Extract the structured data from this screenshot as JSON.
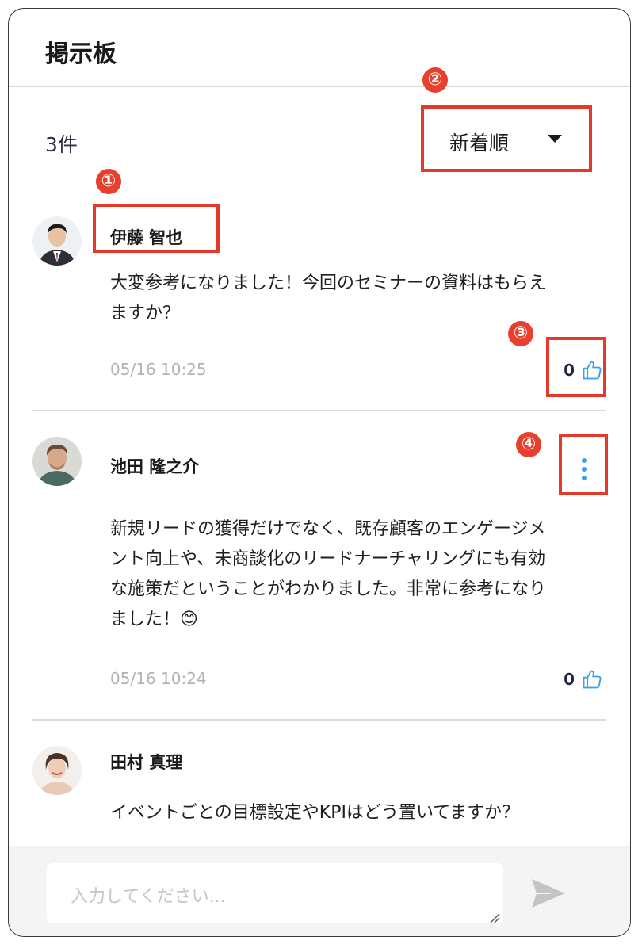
{
  "header": {
    "title": "掲示板"
  },
  "list": {
    "count": "3件"
  },
  "sort": {
    "label": "新着順"
  },
  "annotations": {
    "n1": "①",
    "n2": "②",
    "n3": "③",
    "n4": "④"
  },
  "comments": [
    {
      "author": "伊藤 智也",
      "text": "大変参考になりました！今回のセミナーの資料はもらえますか？",
      "time": "05/16 10:25",
      "likes": "0"
    },
    {
      "author": "池田 隆之介",
      "text": "新規リードの獲得だけでなく、既存顧客のエンゲージメント向上や、未商談化のリードナーチャリングにも有効な施策だということがわかりました。非常に参考になりました！😊",
      "time": "05/16 10:24",
      "likes": "0"
    },
    {
      "author": "田村 真理",
      "text": "イベントごとの目標設定やKPIはどう置いてますか？"
    }
  ],
  "composer": {
    "placeholder": "入力してください..."
  },
  "colors": {
    "accent": "#3aa0e8",
    "highlight": "#e53a2a"
  },
  "icons": {
    "like": "thumbs-up-icon",
    "more": "more-vertical-icon",
    "send": "send-icon",
    "sort": "caret-down-icon"
  }
}
